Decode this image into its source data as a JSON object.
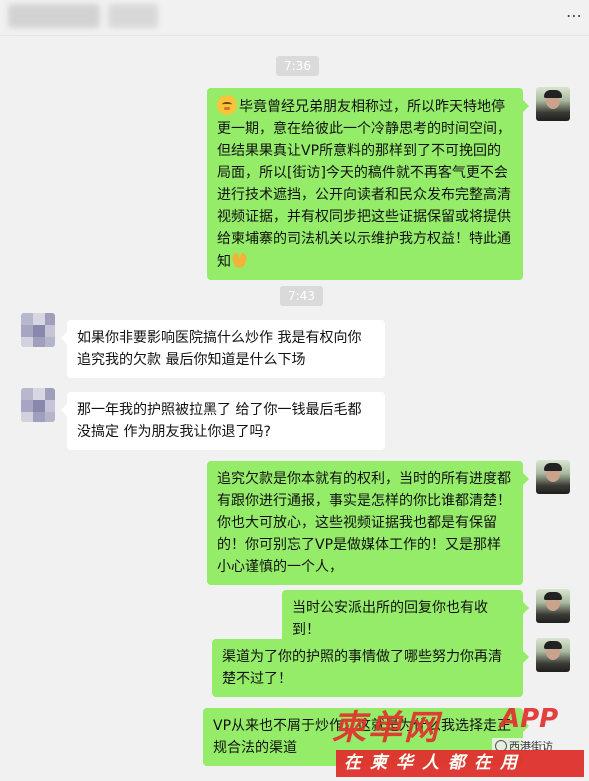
{
  "header": {
    "more_icon": "⋯"
  },
  "timestamps": [
    "7:36",
    "7:43"
  ],
  "messages": [
    {
      "side": "me",
      "text": "毕竟曾经兄弟朋友相称过，所以昨天特地停更一期，意在给彼此一个冷静思考的时间空间，但结果果真让VP所意料的那样到了不可挽回的局面，所以[街访]今天的稿件就不再客气更不会进行技术遮挡，公开向读者和民众发布完整高清视频证据，并有权同步把这些证据保留或将提供给柬埔寨的司法机关以示维护我方权益！特此通知"
    },
    {
      "side": "other",
      "text": "如果你非要影响医院搞什么炒作 我是有权向你追究我的欠款 最后你知道是什么下场"
    },
    {
      "side": "other",
      "text": "那一年我的护照被拉黑了 给了你一钱最后毛都没搞定 作为朋友我让你退了吗?"
    },
    {
      "side": "me",
      "text": "追究欠款是你本就有的权利，当时的所有进度都有跟你进行通报，事实是怎样的你比谁都清楚！你也大可放心，这些视频证据我也都是有保留的！你可别忘了VP是做媒体工作的！又是那样小心谨慎的一个人，"
    },
    {
      "side": "me",
      "text": "当时公安派出所的回复你也有收到！"
    },
    {
      "side": "me",
      "text": "渠道为了你的护照的事情做了哪些努力你再清楚不过了！"
    },
    {
      "side": "me",
      "text": "VP从来也不屑于炒作，这就是为什么我选择走正规合法的渠道"
    }
  ],
  "watermark": {
    "brand": "柬单网",
    "app": "APP",
    "slogan": "在柬华人都在用",
    "account": "西港街访"
  },
  "colors": {
    "my_bubble": "#95ec69",
    "other_bubble": "#ffffff",
    "background": "#f1f1f1",
    "watermark_red": "#e0312d"
  }
}
